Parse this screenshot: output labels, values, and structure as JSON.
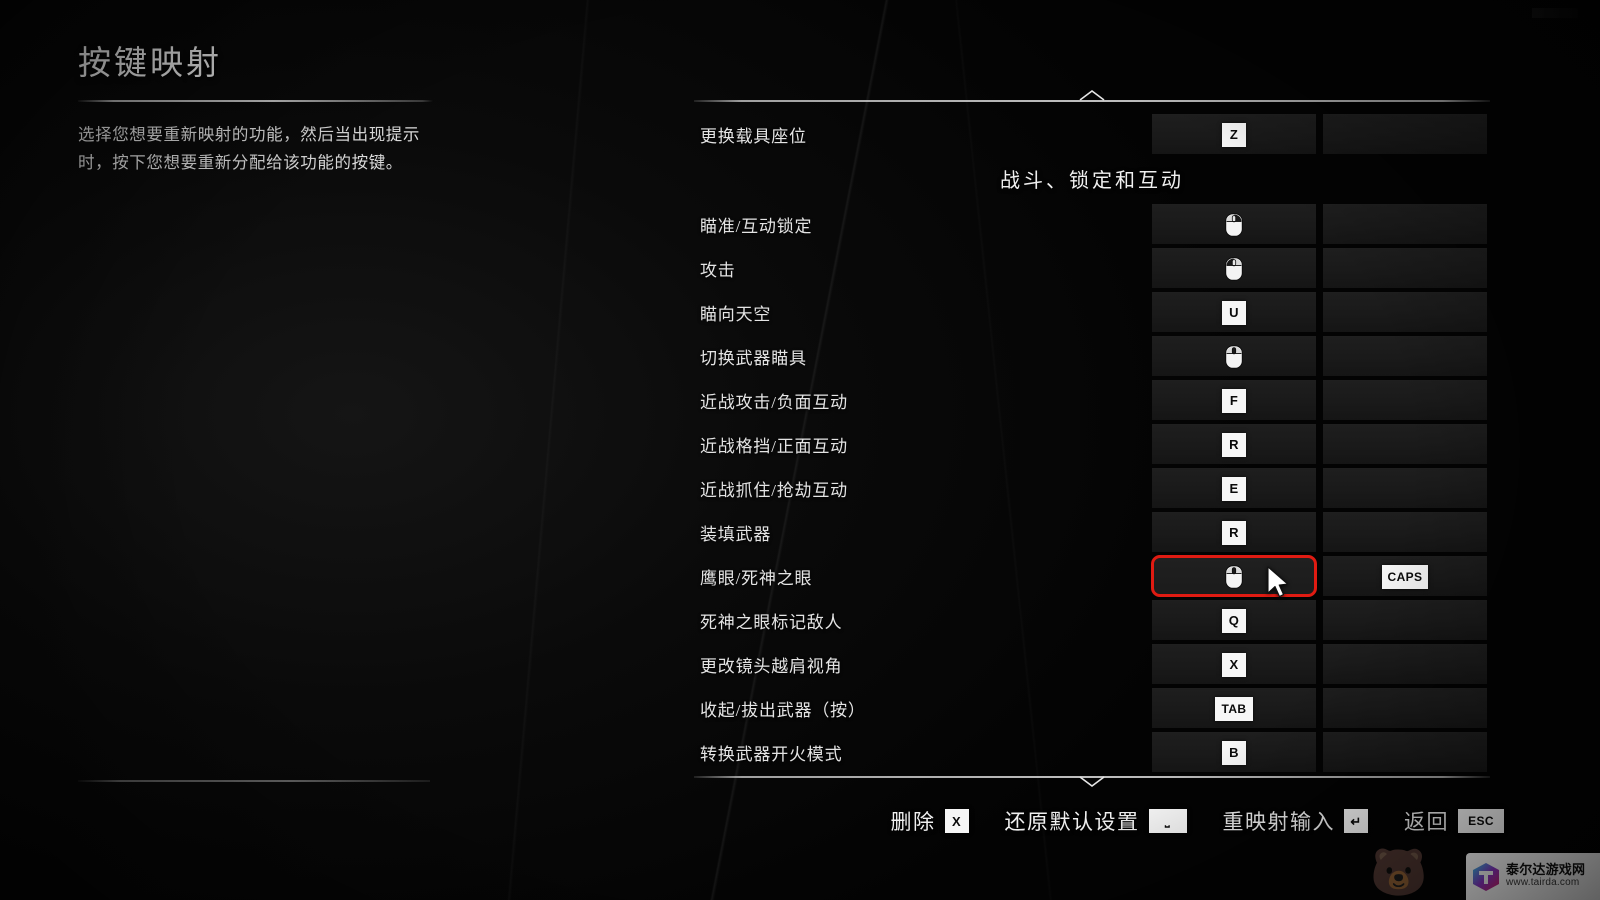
{
  "page": {
    "title": "按键映射",
    "description": "选择您想要重新映射的功能，然后当出现提示时，按下您想要重新分配给该功能的按键。"
  },
  "list": {
    "scroll_up_icon": "chevron-up-icon",
    "scroll_down_icon": "chevron-down-icon",
    "section_header": "战斗、锁定和互动",
    "rows": [
      {
        "label": "更换载具座位",
        "primary": {
          "type": "key",
          "value": "Z"
        },
        "alt": {
          "type": "empty",
          "value": ""
        }
      },
      {
        "label": "瞄准/互动锁定",
        "primary": {
          "type": "mouse",
          "value": "mouse-right"
        },
        "alt": {
          "type": "empty",
          "value": ""
        }
      },
      {
        "label": "攻击",
        "primary": {
          "type": "mouse",
          "value": "mouse-left"
        },
        "alt": {
          "type": "empty",
          "value": ""
        }
      },
      {
        "label": "瞄向天空",
        "primary": {
          "type": "key",
          "value": "U"
        },
        "alt": {
          "type": "empty",
          "value": ""
        }
      },
      {
        "label": "切换武器瞄具",
        "primary": {
          "type": "mouse",
          "value": "mouse-middle"
        },
        "alt": {
          "type": "empty",
          "value": ""
        }
      },
      {
        "label": "近战攻击/负面互动",
        "primary": {
          "type": "key",
          "value": "F"
        },
        "alt": {
          "type": "empty",
          "value": ""
        }
      },
      {
        "label": "近战格挡/正面互动",
        "primary": {
          "type": "key",
          "value": "R"
        },
        "alt": {
          "type": "empty",
          "value": ""
        }
      },
      {
        "label": "近战抓住/抢劫互动",
        "primary": {
          "type": "key",
          "value": "E"
        },
        "alt": {
          "type": "empty",
          "value": ""
        }
      },
      {
        "label": "装填武器",
        "primary": {
          "type": "key",
          "value": "R"
        },
        "alt": {
          "type": "empty",
          "value": ""
        }
      },
      {
        "label": "鹰眼/死神之眼",
        "primary": {
          "type": "mouse",
          "value": "mouse-middle"
        },
        "alt": {
          "type": "key",
          "value": "CAPS"
        },
        "highlighted": true
      },
      {
        "label": "死神之眼标记敌人",
        "primary": {
          "type": "key",
          "value": "Q"
        },
        "alt": {
          "type": "empty",
          "value": ""
        }
      },
      {
        "label": "更改镜头越肩视角",
        "primary": {
          "type": "key",
          "value": "X"
        },
        "alt": {
          "type": "empty",
          "value": ""
        }
      },
      {
        "label": "收起/拔出武器（按）",
        "primary": {
          "type": "key",
          "value": "TAB"
        },
        "alt": {
          "type": "empty",
          "value": ""
        }
      },
      {
        "label": "转换武器开火模式",
        "primary": {
          "type": "key",
          "value": "B"
        },
        "alt": {
          "type": "empty",
          "value": ""
        }
      }
    ]
  },
  "footer": {
    "actions": [
      {
        "label": "删除",
        "key": "X",
        "key_style": "normal"
      },
      {
        "label": "还原默认设置",
        "key": "⎵",
        "key_style": "wide"
      },
      {
        "label": "重映射输入",
        "key": "↵",
        "key_style": "normal"
      },
      {
        "label": "返回",
        "key": "ESC",
        "key_style": "wide"
      }
    ]
  },
  "annotation": {
    "highlight_color": "#e01b12",
    "cursor_icon": "mouse-cursor-arrow"
  },
  "watermark": {
    "brand_cn": "泰尔达游戏网",
    "brand_url": "www.tairda.com",
    "logo_icon": "tairda-logo-icon",
    "bear_icon": "bear-watermark-icon"
  }
}
